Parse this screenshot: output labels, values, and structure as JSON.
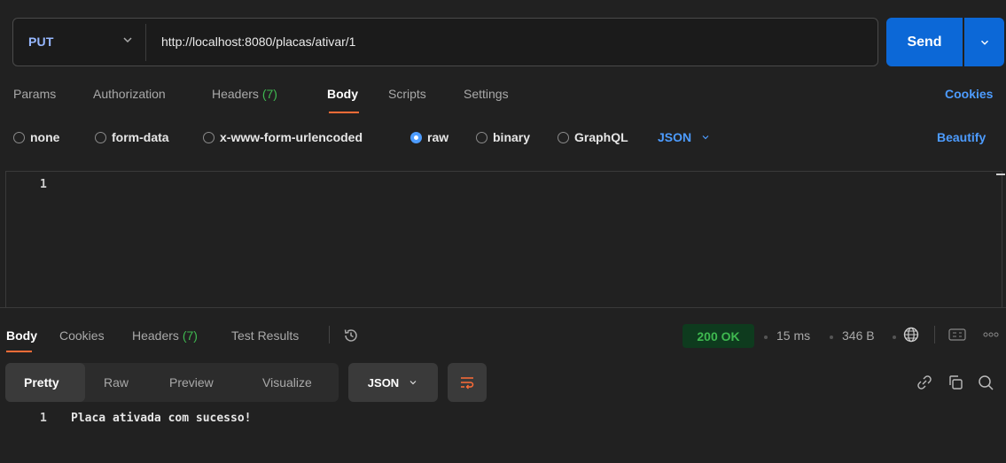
{
  "request": {
    "method": "PUT",
    "url": "http://localhost:8080/placas/ativar/1",
    "send_label": "Send"
  },
  "request_tabs": {
    "params": "Params",
    "authorization": "Authorization",
    "headers": "Headers",
    "headers_count": "(7)",
    "body": "Body",
    "scripts": "Scripts",
    "settings": "Settings",
    "cookies": "Cookies"
  },
  "body_types": {
    "none": "none",
    "form_data": "form-data",
    "urlencoded": "x-www-form-urlencoded",
    "raw": "raw",
    "binary": "binary",
    "graphql": "GraphQL",
    "selected": "raw",
    "language": "JSON",
    "beautify": "Beautify"
  },
  "editor": {
    "line_number": "1",
    "content": ""
  },
  "response_tabs": {
    "body": "Body",
    "cookies": "Cookies",
    "headers": "Headers",
    "headers_count": "(7)",
    "test_results": "Test Results"
  },
  "response_meta": {
    "status": "200 OK",
    "time": "15 ms",
    "size": "346 B"
  },
  "response_view": {
    "pretty": "Pretty",
    "raw": "Raw",
    "preview": "Preview",
    "visualize": "Visualize",
    "format": "JSON"
  },
  "response_body": {
    "line_number": "1",
    "content": "Placa ativada com sucesso!"
  },
  "colors": {
    "accent_blue": "#0c68d7",
    "tab_underline": "#ff6c37",
    "status_green": "#3fb950"
  }
}
